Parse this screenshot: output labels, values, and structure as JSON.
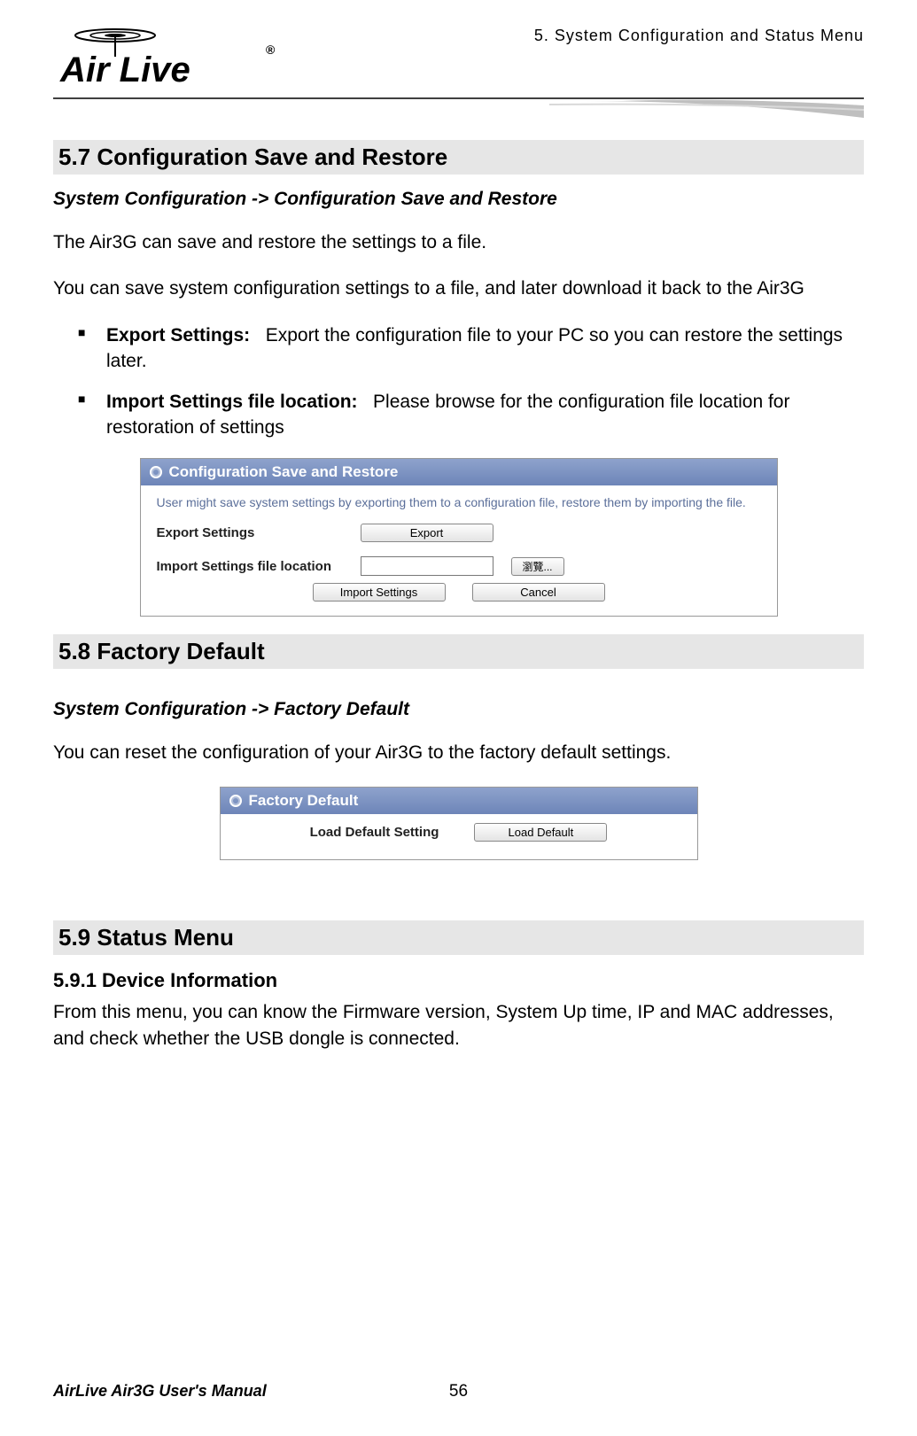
{
  "chapter_header": "5. System Configuration and Status Menu",
  "logo": {
    "brand": "Air Live",
    "reg": "®"
  },
  "section57": {
    "title": "5.7 Configuration  Save  and  Restore",
    "breadcrumb": "System Configuration -> Configuration Save and Restore",
    "para1": "The Air3G can save and restore the settings to a file.",
    "para2": "You can save system configuration settings to a file, and later download it back to the Air3G",
    "bullets": [
      {
        "label": "Export Settings:",
        "text": "Export the configuration file to your PC so you can restore the settings later."
      },
      {
        "label": "Import Settings file location:",
        "text": "Please browse for the configuration file location for restoration of settings"
      }
    ],
    "panel": {
      "title": "Configuration Save and Restore",
      "desc": "User might save system settings by exporting them to a configuration file, restore them by importing the file.",
      "export_label": "Export Settings",
      "export_btn": "Export",
      "import_label": "Import Settings file location",
      "input_value": "",
      "browse_btn": "瀏覽...",
      "import_btn": "Import Settings",
      "cancel_btn": "Cancel"
    }
  },
  "section58": {
    "title": "5.8 Factory  Default",
    "breadcrumb": "System Configuration -> Factory Default",
    "para1": "You can reset the configuration of your Air3G to the factory default settings.",
    "panel": {
      "title": "Factory Default",
      "label": "Load Default Setting",
      "btn": "Load Default"
    }
  },
  "section59": {
    "title": "5.9 Status  Menu",
    "sub": "5.9.1 Device Information",
    "para": "From this menu, you can know the Firmware version, System Up time, IP and MAC addresses, and check whether the USB dongle is connected."
  },
  "footer": {
    "manual": "AirLive Air3G User's Manual",
    "page": "56"
  }
}
